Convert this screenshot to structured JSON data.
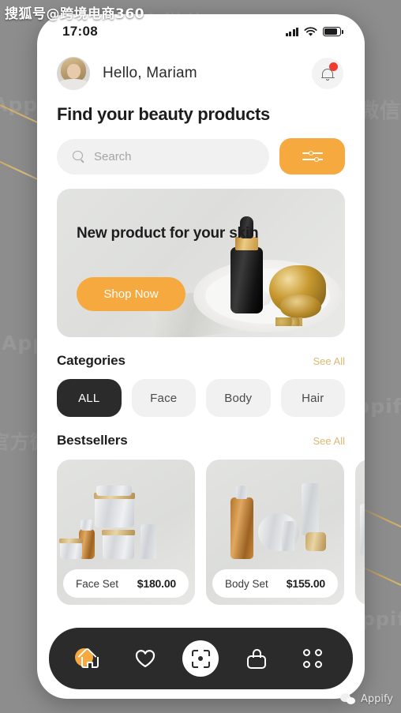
{
  "watermarks": {
    "top_left": "搜狐号@跨境电商360",
    "bottom_right": "Appify",
    "background_repeat": [
      "官方微信 Appify",
      "Appify",
      "官方微信"
    ]
  },
  "status_bar": {
    "time": "17:08",
    "signal_icon": "signal-bars-icon",
    "wifi_icon": "wifi-icon",
    "battery_icon": "battery-icon"
  },
  "header": {
    "greeting": "Hello, Mariam",
    "avatar_icon": "user-avatar",
    "bell_icon": "notification-bell-icon",
    "has_notification": true
  },
  "page_title": "Find your beauty products",
  "search": {
    "placeholder": "Search",
    "value": "",
    "search_icon": "search-icon",
    "filter_icon": "filter-sliders-icon"
  },
  "banner": {
    "heading": "New product for your skin",
    "cta_label": "Shop Now"
  },
  "categories": {
    "title": "Categories",
    "see_all": "See All",
    "items": [
      {
        "label": "ALL",
        "selected": true
      },
      {
        "label": "Face",
        "selected": false
      },
      {
        "label": "Body",
        "selected": false
      },
      {
        "label": "Hair",
        "selected": false
      }
    ]
  },
  "bestsellers": {
    "title": "Bestsellers",
    "see_all": "See All",
    "items": [
      {
        "name": "Face Set",
        "price": "$180.00"
      },
      {
        "name": "Body Set",
        "price": "$155.00"
      }
    ]
  },
  "bottom_nav": {
    "items": [
      {
        "icon": "home-icon",
        "active": true
      },
      {
        "icon": "heart-icon",
        "active": false
      },
      {
        "icon": "scan-icon",
        "active": false
      },
      {
        "icon": "shopping-bag-icon",
        "active": false
      },
      {
        "icon": "grid-menu-icon",
        "active": false
      }
    ]
  },
  "colors": {
    "accent_orange": "#F5A93F",
    "dark": "#2B2B2B",
    "see_all_gold": "#D9B873",
    "notification_red": "#EF3B30",
    "chip_bg": "#F0F1F0",
    "page_bg": "#8D8D8D"
  }
}
